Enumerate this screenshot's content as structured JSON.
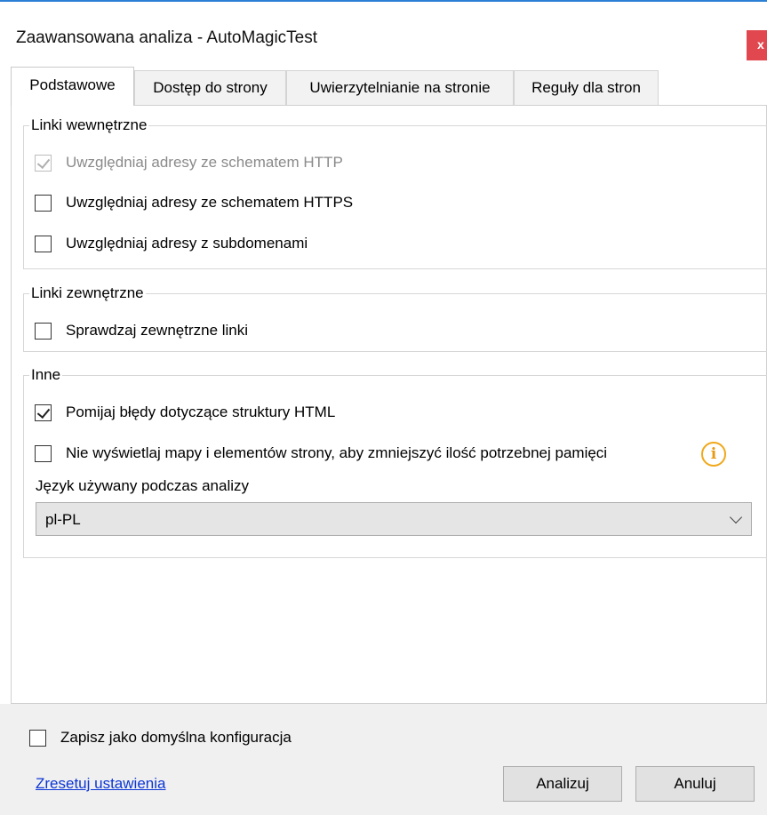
{
  "window": {
    "title": "Zaawansowana analiza - AutoMagicTest",
    "close_label": "x"
  },
  "tabs": [
    {
      "label": "Podstawowe",
      "active": true
    },
    {
      "label": "Dostęp do strony",
      "active": false
    },
    {
      "label": "Uwierzytelnianie na stronie",
      "active": false
    },
    {
      "label": "Reguły dla stron",
      "active": false
    }
  ],
  "internal_links": {
    "legend": "Linki wewnętrzne",
    "options": [
      {
        "label": "Uwzględniaj adresy ze schematem HTTP",
        "checked": true,
        "disabled": true
      },
      {
        "label": "Uwzględniaj adresy ze schematem HTTPS",
        "checked": false,
        "disabled": false
      },
      {
        "label": "Uwzględniaj adresy z subdomenami",
        "checked": false,
        "disabled": false
      }
    ]
  },
  "external_links": {
    "legend": "Linki zewnętrzne",
    "options": [
      {
        "label": "Sprawdzaj zewnętrzne linki",
        "checked": false
      }
    ]
  },
  "other": {
    "legend": "Inne",
    "options": [
      {
        "label": "Pomijaj błędy dotyczące struktury HTML",
        "checked": true
      },
      {
        "label": "Nie wyświetlaj mapy i elementów strony, aby zmniejszyć ilość potrzebnej pamięci",
        "checked": false
      }
    ],
    "info_icon": "info-icon",
    "info_glyph": "i",
    "info_color": "#f0a81b",
    "language_label": "Język używany podczas analizy",
    "language_value": "pl-PL"
  },
  "footer": {
    "save_default_label": "Zapisz jako domyślna konfiguracja",
    "save_default_checked": false,
    "reset_link": "Zresetuj ustawienia",
    "analyze_button": "Analizuj",
    "cancel_button": "Anuluj"
  },
  "colors": {
    "accent": "#2b7fd4",
    "close": "#e0474f",
    "link": "#0b35d6"
  }
}
